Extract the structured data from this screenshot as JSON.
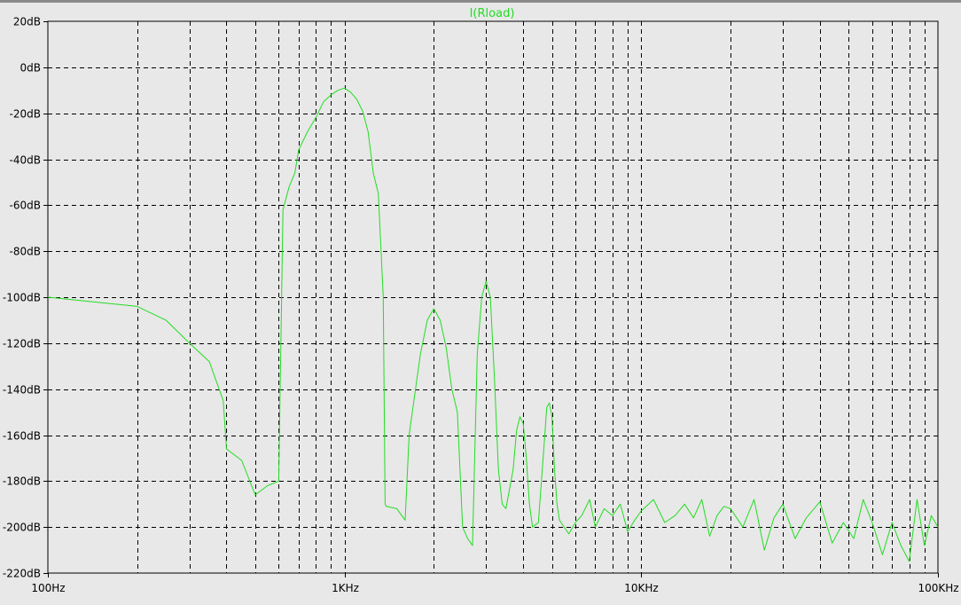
{
  "colors": {
    "background": "#e8e8e8",
    "trace": "#22dd22",
    "grid": "#000000",
    "axis": "#000000"
  },
  "chart_data": {
    "type": "line",
    "title": "I(Rload)",
    "xlabel": "",
    "ylabel": "",
    "x_scale": "log",
    "xlim": [
      100,
      100000
    ],
    "ylim": [
      -220,
      20
    ],
    "grid": true,
    "x_ticks": [
      {
        "value": 100,
        "label": "100Hz"
      },
      {
        "value": 1000,
        "label": "1KHz"
      },
      {
        "value": 10000,
        "label": "10KHz"
      },
      {
        "value": 100000,
        "label": "100KHz"
      }
    ],
    "y_ticks": [
      {
        "value": 20,
        "label": "20dB"
      },
      {
        "value": 0,
        "label": "0dB"
      },
      {
        "value": -20,
        "label": "-20dB"
      },
      {
        "value": -40,
        "label": "-40dB"
      },
      {
        "value": -60,
        "label": "-60dB"
      },
      {
        "value": -80,
        "label": "-80dB"
      },
      {
        "value": -100,
        "label": "-100dB"
      },
      {
        "value": -120,
        "label": "-120dB"
      },
      {
        "value": -140,
        "label": "-140dB"
      },
      {
        "value": -160,
        "label": "-160dB"
      },
      {
        "value": -180,
        "label": "-180dB"
      },
      {
        "value": -200,
        "label": "-200dB"
      },
      {
        "value": -220,
        "label": "-220dB"
      }
    ],
    "series": [
      {
        "name": "I(Rload)",
        "x": [
          100,
          200,
          250,
          300,
          350,
          390,
          400,
          450,
          500,
          550,
          600,
          605,
          620,
          650,
          680,
          700,
          750,
          800,
          850,
          900,
          950,
          1000,
          1050,
          1100,
          1150,
          1200,
          1250,
          1300,
          1350,
          1370,
          1380,
          1500,
          1600,
          1650,
          1700,
          1800,
          1900,
          2000,
          2100,
          2200,
          2300,
          2400,
          2500,
          2600,
          2700,
          2800,
          2900,
          3000,
          3100,
          3200,
          3300,
          3400,
          3500,
          3700,
          3800,
          3900,
          4000,
          4100,
          4200,
          4300,
          4500,
          4700,
          4800,
          4900,
          5000,
          5100,
          5200,
          5300,
          5500,
          5700,
          6000,
          6300,
          6700,
          7000,
          7500,
          8000,
          8500,
          9000,
          9500,
          10000,
          11000,
          12000,
          13000,
          14000,
          15000,
          16000,
          17000,
          18000,
          19000,
          20000,
          22000,
          24000,
          26000,
          28000,
          30000,
          33000,
          36000,
          40000,
          44000,
          48000,
          52000,
          56000,
          60000,
          65000,
          70000,
          75000,
          80000,
          85000,
          90000,
          95000,
          100000
        ],
        "y": [
          -100,
          -104,
          -110,
          -120,
          -128,
          -145,
          -166,
          -171,
          -186,
          -182,
          -180,
          -150,
          -62,
          -52,
          -46,
          -36,
          -28,
          -22,
          -15,
          -12,
          -10,
          -9,
          -11,
          -14,
          -19,
          -28,
          -46,
          -55,
          -100,
          -190,
          -191,
          -192,
          -197,
          -160,
          -148,
          -125,
          -110,
          -105,
          -110,
          -122,
          -140,
          -150,
          -200,
          -205,
          -208,
          -125,
          -100,
          -93,
          -100,
          -135,
          -175,
          -190,
          -192,
          -175,
          -158,
          -152,
          -155,
          -170,
          -190,
          -200,
          -198,
          -165,
          -148,
          -146,
          -152,
          -175,
          -190,
          -197,
          -200,
          -203,
          -198,
          -195,
          -188,
          -200,
          -192,
          -195,
          -190,
          -202,
          -197,
          -193,
          -188,
          -198,
          -195,
          -190,
          -196,
          -188,
          -204,
          -195,
          -191,
          -192,
          -200,
          -188,
          -210,
          -196,
          -190,
          -205,
          -196,
          -189,
          -207,
          -198,
          -205,
          -188,
          -198,
          -212,
          -198,
          -208,
          -215,
          -188,
          -208,
          -195,
          -200
        ]
      }
    ]
  }
}
